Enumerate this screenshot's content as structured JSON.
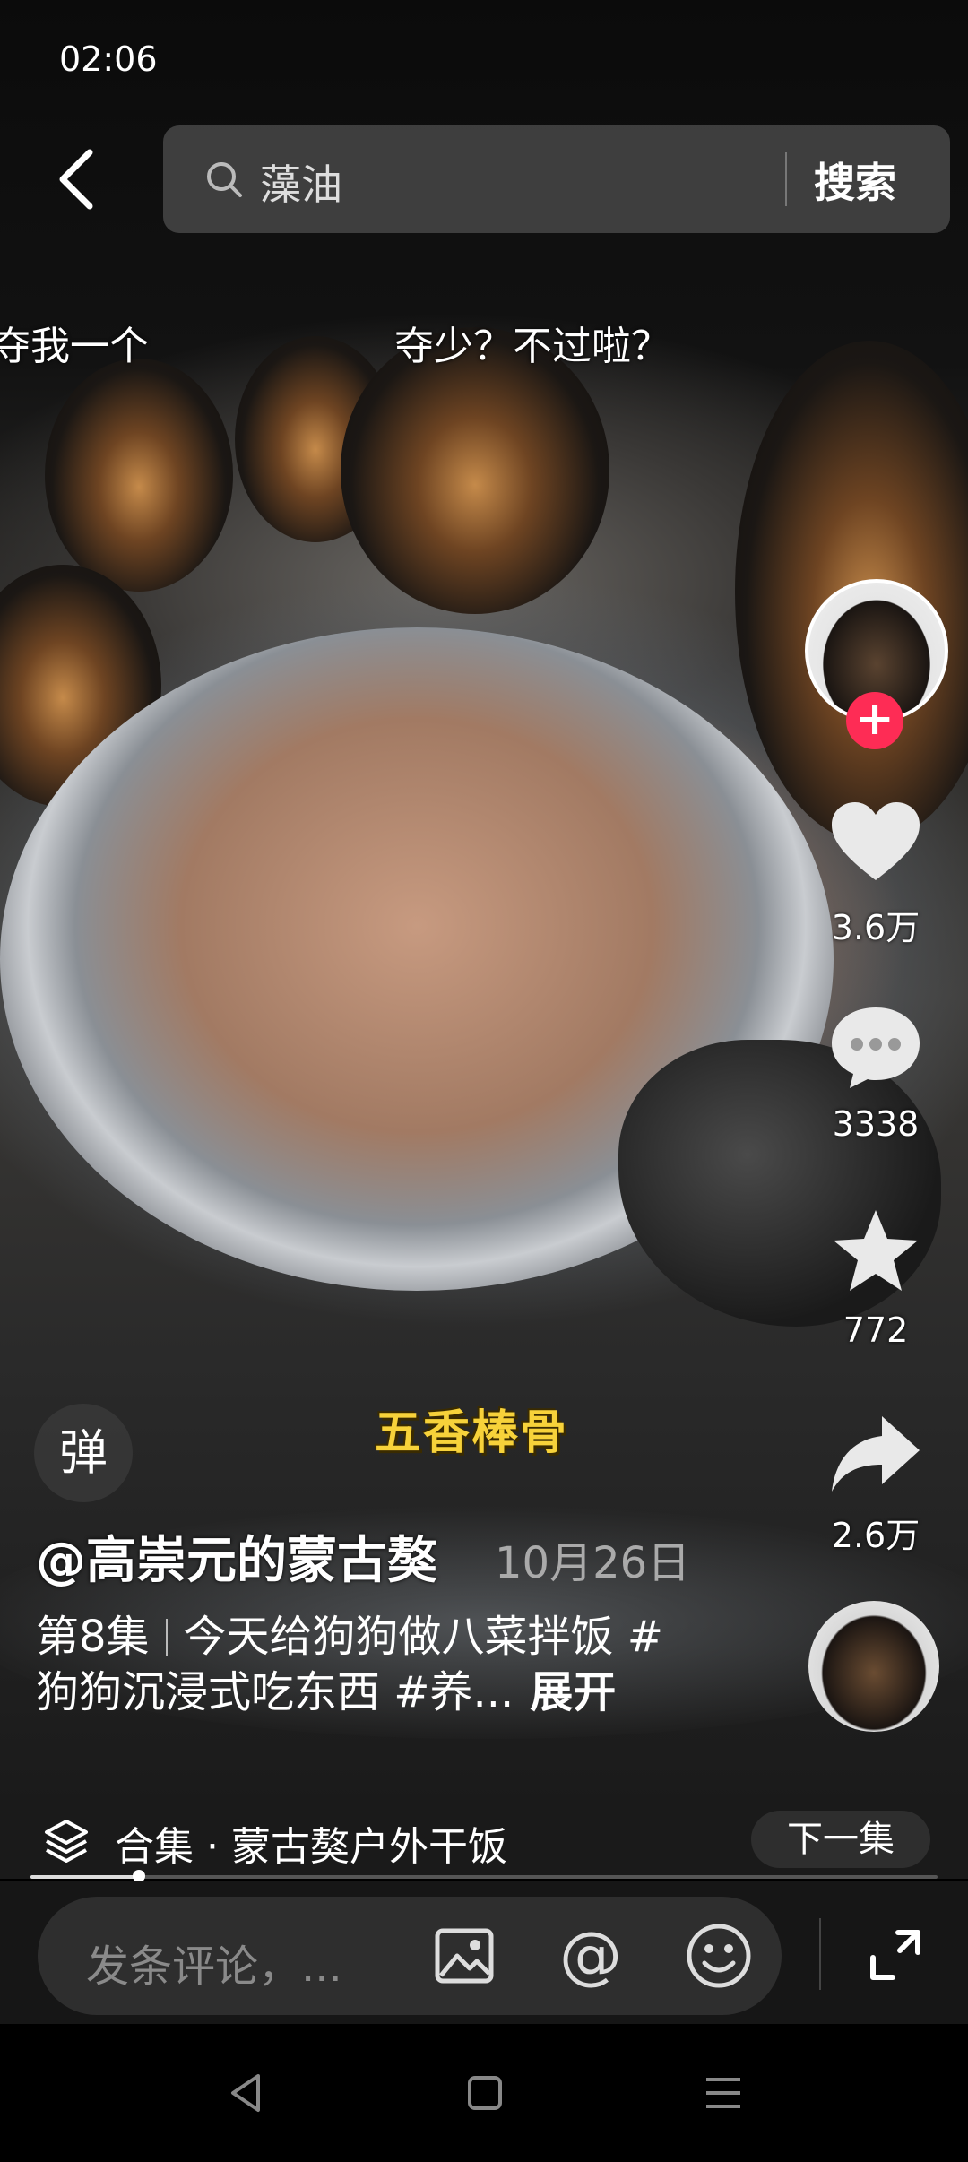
{
  "status_bar": {
    "time": "02:06"
  },
  "search": {
    "query": "藻油",
    "button": "搜索"
  },
  "danmaku": [
    "夺我一个",
    "夺少？不过啦？"
  ],
  "right_rail": {
    "like_count": "3.6万",
    "comment_count": "3338",
    "favorite_count": "772",
    "share_count": "2.6万"
  },
  "danmaku_toggle": "弹",
  "video_caption": "五香棒骨",
  "post": {
    "author": "@高崇元的蒙古獒",
    "date": "10月26日",
    "episode": "第8集",
    "desc_line1": "今天给狗狗做八菜拌饭 #",
    "desc_line2": "狗狗沉浸式吃东西 #养...",
    "expand": "展开"
  },
  "collection": {
    "label": "合集 · 蒙古獒户外干饭",
    "next": "下一集"
  },
  "progress": {
    "fraction": 0.12
  },
  "comment": {
    "placeholder": "发条评论，..."
  },
  "colors": {
    "accent": "#fe2c55",
    "caption": "#f7d23a"
  }
}
